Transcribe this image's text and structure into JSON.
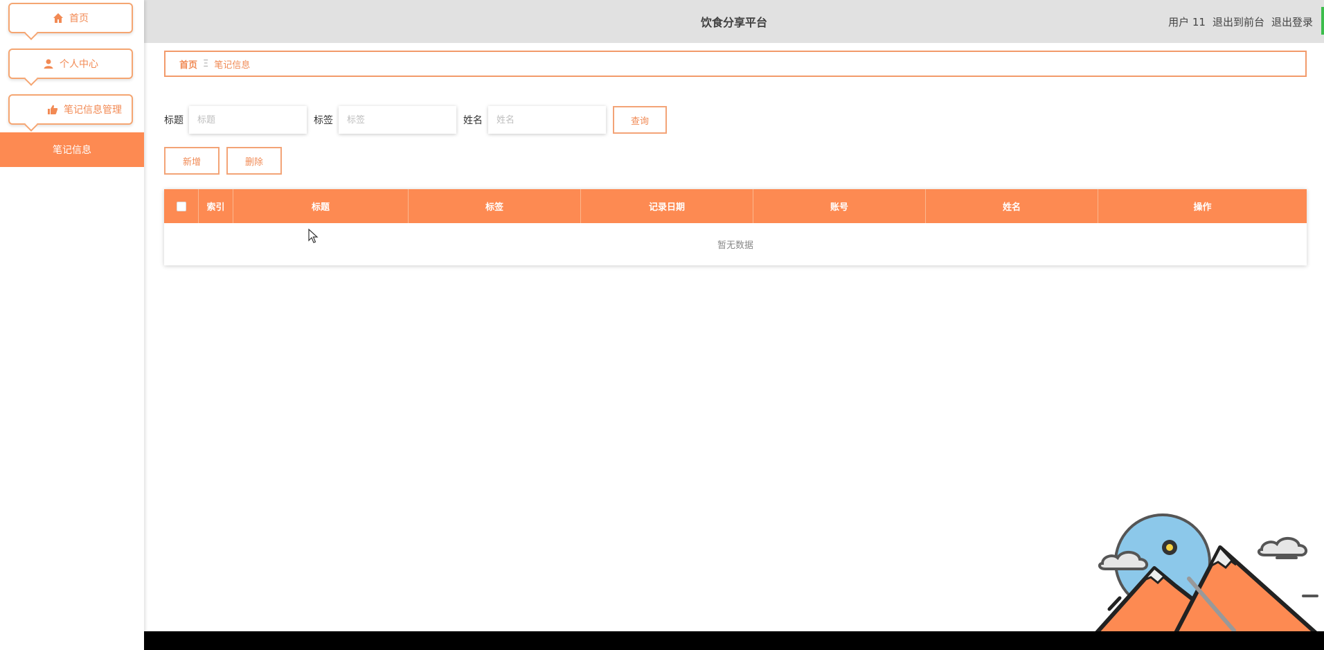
{
  "sidebar": {
    "menus": [
      {
        "label": "首页",
        "icon": "home-icon"
      },
      {
        "label": "个人中心",
        "icon": "user-icon"
      },
      {
        "label": "笔记信息管理",
        "icon": "thumb-icon"
      }
    ],
    "active_submenu": "笔记信息"
  },
  "header": {
    "title": "饮食分享平台",
    "user": "用户 11",
    "back_front": "退出到前台",
    "logout": "退出登录"
  },
  "breadcrumb": {
    "home": "首页",
    "separator": "Ξ",
    "current": "笔记信息"
  },
  "search": {
    "title_label": "标题",
    "title_placeholder": "标题",
    "tag_label": "标签",
    "tag_placeholder": "标签",
    "name_label": "姓名",
    "name_placeholder": "姓名",
    "query_button": "查询"
  },
  "actions": {
    "add": "新增",
    "delete": "删除"
  },
  "table": {
    "columns": [
      "索引",
      "标题",
      "标签",
      "记录日期",
      "账号",
      "姓名",
      "操作"
    ],
    "empty_text": "暂无数据"
  },
  "colors": {
    "accent": "#fd8a52",
    "border": "#f3a376",
    "header_bg": "#e1e1e1"
  }
}
